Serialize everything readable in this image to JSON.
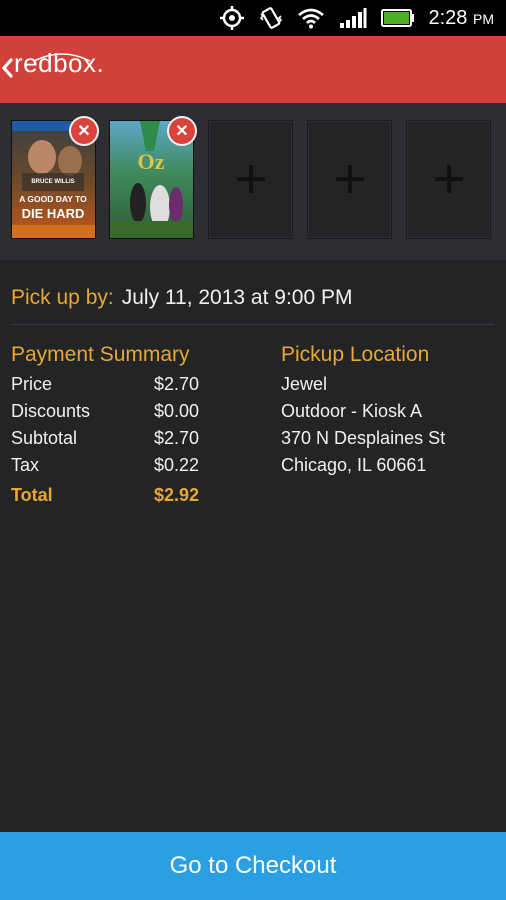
{
  "status": {
    "time": "2:28",
    "ampm": "PM"
  },
  "appbar": {
    "logo": "redbox."
  },
  "tray": {
    "posters": [
      {
        "title": "A Good Day to Die Hard",
        "top_text": "BRUCE WILLIS",
        "line1": "A GOOD DAY TO",
        "line2": "DIE HARD"
      },
      {
        "title": "Oz the Great and Powerful",
        "mark": "Oz"
      }
    ]
  },
  "pickup": {
    "label": "Pick up by:",
    "value": "July 11, 2013 at 9:00 PM"
  },
  "payment": {
    "title": "Payment Summary",
    "rows": [
      {
        "label": "Price",
        "value": "$2.70"
      },
      {
        "label": "Discounts",
        "value": "$0.00"
      },
      {
        "label": "Subtotal",
        "value": "$2.70"
      },
      {
        "label": "Tax",
        "value": "$0.22"
      }
    ],
    "total": {
      "label": "Total",
      "value": "$2.92"
    }
  },
  "location": {
    "title": "Pickup Location",
    "lines": [
      "Jewel",
      "Outdoor - Kiosk A",
      "370 N Desplaines St",
      "Chicago, IL 60661"
    ]
  },
  "checkout": {
    "label": "Go to Checkout"
  },
  "colors": {
    "accent": "#e8a733",
    "brand": "#d1403a",
    "button": "#2b9fe4",
    "remove": "#d9433b"
  }
}
